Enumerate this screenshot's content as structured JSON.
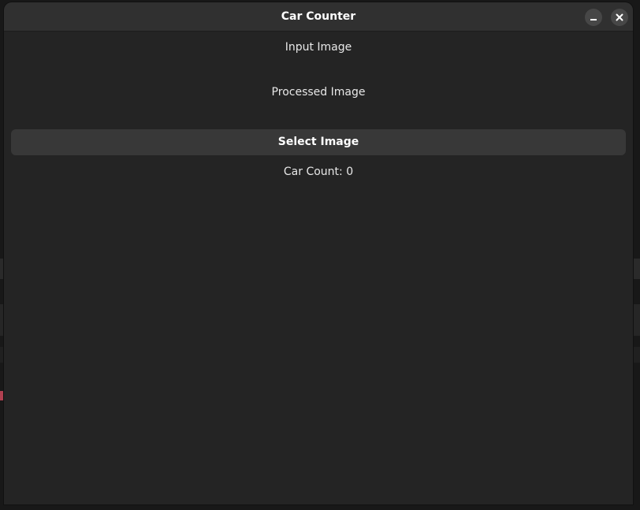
{
  "window": {
    "title": "Car Counter"
  },
  "main": {
    "input_image_label": "Input Image",
    "processed_image_label": "Processed Image",
    "select_button_label": "Select Image",
    "car_count_text": "Car Count: 0"
  },
  "icons": {
    "minimize": "minimize-icon",
    "close": "close-icon"
  },
  "colors": {
    "window_bg": "#242424",
    "titlebar_bg": "#303030",
    "button_bg": "#383838",
    "text": "#e8e8e8"
  }
}
